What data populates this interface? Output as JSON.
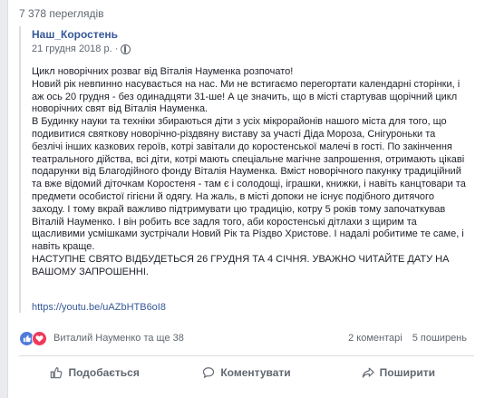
{
  "views": "7 378 переглядів",
  "shared_post": {
    "author": "Наш_Коростень",
    "date": "21 грудня 2018 р. ·",
    "paragraphs": [
      "Цикл новорічних розваг від Віталія Науменка розпочато!",
      "Новий рік невпинно насувається на нас. Ми не встигаємо перегортати календарні сторінки, і аж ось 20 грудня - без одинадцяти 31-ше! А це значить, що в місті стартував щорічний цикл новорічних свят від Віталія Науменка.",
      "В Будинку науки та техніки збираються діти з усіх мікрорайонів нашого міста для того, що подивитися святкову новорічно-різдвяну виставу за участі Діда Мороза, Снігуроньки та безлічі інших казкових героїв, котрі завітали до коростенської малечі в гості. По закінчення театрального дійства, всі діти, котрі мають спеціальне магічне запрошення, отримають цікаві подарунки від Благодійного фонду Віталія Науменка. Вміст новорічного пакунку традиційний та вже відомий діточкам Коростеня - там є і солодощі, іграшки, книжки, і навіть канцтовари та предмети особистої гігієни й одягу. На жаль, в місті допоки не існує подібного дитячого заходу. І тому вкрай важливо підтримувати цю традицію, котру 5 років тому започаткував Віталій Науменко. І він робить все задля того, аби коростенські дітлахи з щирим та щасливими усмішками зустрічали Новий Рік та Різдво Христове. І надалі робитиме те саме, і навіть краще.",
      "НАСТУПНЕ СВЯТО ВІДБУДЕТЬСЯ 26 ГРУДНЯ ТА 4 СІЧНЯ. УВАЖНО ЧИТАЙТЕ ДАТУ НА ВАШОМУ ЗАПРОШЕННІ."
    ],
    "link": "https://youtu.be/uAZbHTB6oI8"
  },
  "stats": {
    "reactions_text": "Виталий Науменко та ще 38",
    "comments": "2 коментарі",
    "shares": "5 поширень"
  },
  "actions": {
    "like": "Подобається",
    "comment": "Коментувати",
    "share": "Поширити"
  },
  "colors": {
    "link": "#365899",
    "like": "#4f7bd9",
    "love": "#f0395a"
  }
}
